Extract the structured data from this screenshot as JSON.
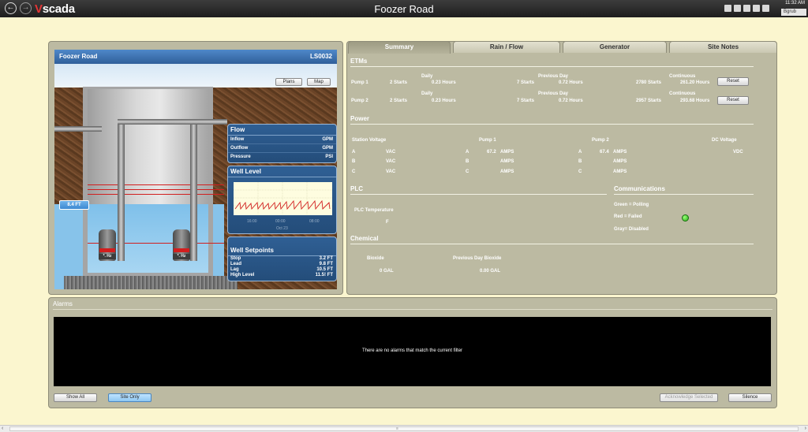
{
  "app": {
    "title": "Foozer Road",
    "logo_v": "V",
    "logo_rest": "scada",
    "time": "11:32 AM",
    "user": "Bgrub"
  },
  "site": {
    "name": "Foozer Road",
    "id": "LS0032",
    "plans_label": "Plans",
    "map_label": "Map",
    "level_tag": "8.4 FT",
    "pump1_hz": "*. Hz",
    "pump2_hz": "*. Hz",
    "flow": {
      "title": "Flow",
      "rows": [
        {
          "label": "Inflow",
          "unit": "GPM"
        },
        {
          "label": "Outflow",
          "unit": "GPM"
        },
        {
          "label": "Pressure",
          "unit": "PSI"
        }
      ]
    },
    "well_level": {
      "title": "Well Level",
      "ticks": [
        "16:00",
        "00:00",
        "08:00"
      ],
      "date": "Oct 23"
    },
    "setpoints": {
      "title": "Well Setpoints",
      "rows": [
        {
          "label": "Stop",
          "value": "3.2 FT"
        },
        {
          "label": "Lead",
          "value": "9.8 FT"
        },
        {
          "label": "Lag",
          "value": "10.5 FT"
        },
        {
          "label": "High Level",
          "value": "11.5! FT"
        }
      ]
    }
  },
  "tabs": [
    {
      "label": "Summary",
      "active": true
    },
    {
      "label": "Rain / Flow",
      "active": false
    },
    {
      "label": "Generator",
      "active": false
    },
    {
      "label": "Site Notes",
      "active": false
    }
  ],
  "etms": {
    "title": "ETMs",
    "daily_label": "Daily",
    "prev_label": "Previous Day",
    "cont_label": "Continuous",
    "reset_label": "Reset",
    "pumps": [
      {
        "name": "Pump 1",
        "daily_starts": "2 Starts",
        "daily_hours": "0.23 Hours",
        "prev_starts": "7 Starts",
        "prev_hours": "0.72 Hours",
        "cont_starts": "2780 Starts",
        "cont_hours": "261.20 Hours"
      },
      {
        "name": "Pump 2",
        "daily_starts": "2 Starts",
        "daily_hours": "0.23 Hours",
        "prev_starts": "7 Starts",
        "prev_hours": "0.72 Hours",
        "cont_starts": "2957 Starts",
        "cont_hours": "293.68 Hours"
      }
    ]
  },
  "power": {
    "title": "Power",
    "station_voltage": "Station Voltage",
    "pump1": "Pump 1",
    "pump2": "Pump 2",
    "dc_voltage": "DC Voltage",
    "phases": [
      "A",
      "B",
      "C"
    ],
    "vac": "VAC",
    "amps": "AMPS",
    "vdc": "VDC",
    "pump1_a": "67.2",
    "pump2_a": "67.4"
  },
  "plc": {
    "title": "PLC",
    "temp_label": "PLC Temperature",
    "temp_unit": "F"
  },
  "comms": {
    "title": "Communications",
    "green": "Green = Polling",
    "red": "Red = Failed",
    "gray": "Gray= Disabled"
  },
  "chemical": {
    "title": "Chemical",
    "bioxide_label": "Bioxide",
    "prev_label": "Previous Day Bioxide",
    "bioxide_value": "0 GAL",
    "prev_value": "0.00 GAL"
  },
  "alarms": {
    "title": "Alarms",
    "empty_msg": "There are no alarms that match the current filter",
    "show_all": "Show All",
    "site_only": "Site Only",
    "acknowledge": "Acknowledge Selected",
    "silence": "Silence"
  },
  "colors": {
    "background": "#fbf6cf",
    "panel": "#bcbaa2",
    "accent_blue": "#2f5f94",
    "status_green": "#27b216",
    "alarm_red": "#d21e1e"
  },
  "icons": [
    "back-icon",
    "forward-icon",
    "tag-icon",
    "settings-icon",
    "report-icon",
    "print-icon",
    "bell-icon"
  ]
}
